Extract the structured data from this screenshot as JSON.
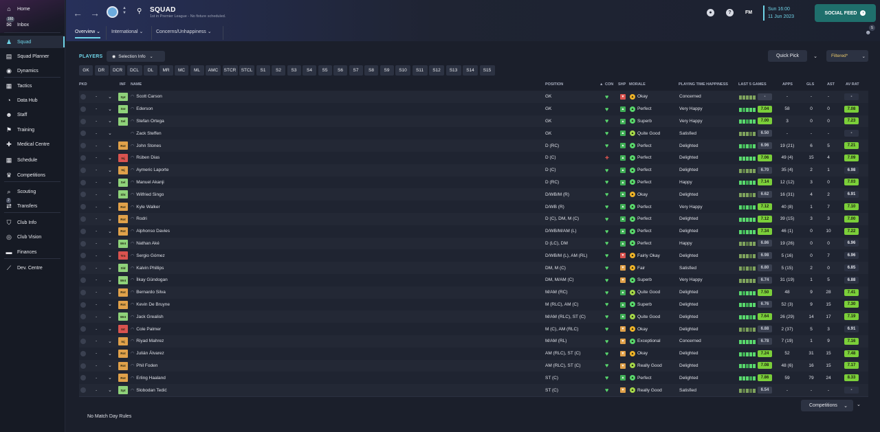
{
  "sidebar": {
    "items": [
      {
        "label": "Home",
        "icon": "home-icon"
      },
      {
        "label": "Inbox",
        "icon": "inbox-icon",
        "badge": "160"
      },
      {
        "label": "Squad",
        "icon": "squad-icon",
        "active": true
      },
      {
        "label": "Squad Planner",
        "icon": "planner-icon"
      },
      {
        "label": "Dynamics",
        "icon": "dynamics-icon"
      },
      {
        "label": "Tactics",
        "icon": "tactics-icon"
      },
      {
        "label": "Data Hub",
        "icon": "data-hub-icon"
      },
      {
        "label": "Staff",
        "icon": "staff-icon"
      },
      {
        "label": "Training",
        "icon": "training-icon"
      },
      {
        "label": "Medical Centre",
        "icon": "medical-icon"
      },
      {
        "label": "Schedule",
        "icon": "schedule-icon"
      },
      {
        "label": "Competitions",
        "icon": "trophy-icon"
      },
      {
        "label": "Scouting",
        "icon": "scouting-icon"
      },
      {
        "label": "Transfers",
        "icon": "transfers-icon",
        "badge": "2"
      },
      {
        "label": "Club Info",
        "icon": "club-info-icon"
      },
      {
        "label": "Club Vision",
        "icon": "club-vision-icon"
      },
      {
        "label": "Finances",
        "icon": "finances-icon"
      },
      {
        "label": "Dev. Centre",
        "icon": "dev-centre-icon"
      }
    ]
  },
  "header": {
    "title": "SQUAD",
    "subtitle": "1st in Premier League - No fixture scheduled.",
    "tabs": [
      "Overview",
      "International",
      "Concerns/Unhappiness"
    ],
    "fm": "FM",
    "date_line1": "Sun 16:00",
    "date_line2": "11 Jun 2023",
    "social_feed": "SOCIAL FEED",
    "notif_count": "5"
  },
  "toolbar": {
    "players_label": "PLAYERS",
    "selection_info": "Selection Info",
    "quick_pick": "Quick Pick",
    "filtered": "Filtered*",
    "positions": [
      "GK",
      "DR",
      "DCR",
      "DCL",
      "DL",
      "MR",
      "MC",
      "ML",
      "AMC",
      "STCR",
      "STCL",
      "S1",
      "S2",
      "S3",
      "S4",
      "S5",
      "S6",
      "S7",
      "S8",
      "S9",
      "S10",
      "S11",
      "S12",
      "S13",
      "S14",
      "S15"
    ]
  },
  "columns": {
    "pkd": "PKD",
    "inf": "INF",
    "name": "NAME",
    "position": "POSITION",
    "con": "CON",
    "shp": "SHP",
    "morale": "MORALE",
    "happiness": "PLAYING TIME HAPPINESS",
    "last5": "LAST 5 GAMES",
    "apps": "APPS",
    "gls": "GLS",
    "ast": "AST",
    "avrat": "AV RAT"
  },
  "players": [
    {
      "name": "Scott Carson",
      "inf": "Spt",
      "inf_color": "#8fd27a",
      "position": "GK",
      "shp": "down",
      "morale": "Okay",
      "morale_color": "#f0b429",
      "happiness": "Concerned",
      "form": "-",
      "apps": "-",
      "gls": "-",
      "ast": "-",
      "avrat": "-",
      "gray": true
    },
    {
      "name": "Ederson",
      "inf": "SnI",
      "inf_color": "#8fd27a",
      "position": "GK",
      "shp": "up",
      "morale": "Perfect",
      "morale_color": "#59d86d",
      "happiness": "Very Happy",
      "form": "7.04",
      "apps": "58",
      "gls": "0",
      "ast": "0",
      "avrat": "7.08"
    },
    {
      "name": "Stefan Ortega",
      "inf": "Sel",
      "inf_color": "#8fd27a",
      "position": "GK",
      "shp": "up",
      "morale": "Superb",
      "morale_color": "#59d86d",
      "happiness": "Very Happy",
      "form": "7.00",
      "apps": "3",
      "gls": "0",
      "ast": "0",
      "avrat": "7.23"
    },
    {
      "name": "Zack Steffen",
      "inf": "",
      "inf_color": "",
      "position": "GK",
      "shp": "up",
      "morale": "Quite Good",
      "morale_color": "#a6d94a",
      "happiness": "Satisfied",
      "form": "6.50",
      "apps": "-",
      "gls": "-",
      "ast": "-",
      "avrat": "-",
      "gray": true
    },
    {
      "name": "John Stones",
      "inf": "Rot",
      "inf_color": "#e0a14a",
      "position": "D (RC)",
      "shp": "up",
      "morale": "Perfect",
      "morale_color": "#59d86d",
      "happiness": "Delighted",
      "form": "6.96",
      "apps": "19 (21)",
      "gls": "6",
      "ast": "5",
      "avrat": "7.21"
    },
    {
      "name": "Rúben Dias",
      "inf": "Inj",
      "inf_color": "#d9534f",
      "position": "D (C)",
      "shp": "up",
      "morale": "Perfect",
      "morale_color": "#59d86d",
      "happiness": "Delighted",
      "form": "7.06",
      "apps": "49 (4)",
      "gls": "15",
      "ast": "4",
      "avrat": "7.09"
    },
    {
      "name": "Aymeric Laporte",
      "inf": "Inj",
      "inf_color": "#e0a14a",
      "position": "D (C)",
      "shp": "up",
      "morale": "Perfect",
      "morale_color": "#59d86d",
      "happiness": "Delighted",
      "form": "6.70",
      "apps": "35 (4)",
      "gls": "2",
      "ast": "1",
      "avrat": "6.98",
      "gray": true
    },
    {
      "name": "Manuel Akanji",
      "inf": "Sel",
      "inf_color": "#8fd27a",
      "position": "D (RC)",
      "shp": "up",
      "morale": "Perfect",
      "morale_color": "#59d86d",
      "happiness": "Happy",
      "form": "7.14",
      "apps": "12 (12)",
      "gls": "3",
      "ast": "0",
      "avrat": "7.03"
    },
    {
      "name": "Wilfried Singo",
      "inf": "Sht",
      "inf_color": "#8fd27a",
      "position": "D/WB/M (R)",
      "shp": "up",
      "morale": "Okay",
      "morale_color": "#f0b429",
      "happiness": "Delighted",
      "form": "6.62",
      "apps": "16 (31)",
      "gls": "4",
      "ast": "2",
      "avrat": "6.91",
      "gray": true
    },
    {
      "name": "Kyle Walker",
      "inf": "Rot",
      "inf_color": "#e0a14a",
      "position": "D/WB (R)",
      "shp": "up",
      "morale": "Perfect",
      "morale_color": "#59d86d",
      "happiness": "Very Happy",
      "form": "7.12",
      "apps": "40 (8)",
      "gls": "1",
      "ast": "7",
      "avrat": "7.10"
    },
    {
      "name": "Rodri",
      "inf": "Rot",
      "inf_color": "#e0a14a",
      "position": "D (C), DM, M (C)",
      "shp": "up",
      "morale": "Perfect",
      "morale_color": "#59d86d",
      "happiness": "Delighted",
      "form": "7.12",
      "apps": "39 (15)",
      "gls": "3",
      "ast": "3",
      "avrat": "7.00"
    },
    {
      "name": "Alphonso Davies",
      "inf": "Rot",
      "inf_color": "#e0a14a",
      "position": "D/WB/M/AM (L)",
      "shp": "up",
      "morale": "Perfect",
      "morale_color": "#59d86d",
      "happiness": "Delighted",
      "form": "7.34",
      "apps": "46 (1)",
      "gls": "0",
      "ast": "10",
      "avrat": "7.22"
    },
    {
      "name": "Nathan Aké",
      "inf": "Wnt",
      "inf_color": "#8fd27a",
      "position": "D (LC), DM",
      "shp": "up",
      "morale": "Perfect",
      "morale_color": "#59d86d",
      "happiness": "Happy",
      "form": "6.86",
      "apps": "19 (26)",
      "gls": "0",
      "ast": "0",
      "avrat": "6.96",
      "gray": true
    },
    {
      "name": "Sergio Gómez",
      "inf": "Trn",
      "inf_color": "#d9534f",
      "position": "D/WB/M (L), AM (RL)",
      "shp": "down",
      "morale": "Fairly Okay",
      "morale_color": "#f0b429",
      "happiness": "Delighted",
      "form": "6.98",
      "apps": "5 (16)",
      "gls": "0",
      "ast": "7",
      "avrat": "6.96",
      "gray": true
    },
    {
      "name": "Kalvin Phillips",
      "inf": "Sld",
      "inf_color": "#8fd27a",
      "position": "DM, M (C)",
      "shp": "down",
      "morale": "Fair",
      "morale_color": "#f0b429",
      "happiness": "Satisfied",
      "form": "6.80",
      "apps": "5 (15)",
      "gls": "2",
      "ast": "0",
      "avrat": "6.85",
      "gray": true
    },
    {
      "name": "İlkay Gündogan",
      "inf": "Wnt",
      "inf_color": "#8fd27a",
      "position": "DM, M/AM (C)",
      "shp": "down",
      "morale": "Superb",
      "morale_color": "#59d86d",
      "happiness": "Very Happy",
      "form": "6.74",
      "apps": "31 (19)",
      "gls": "1",
      "ast": "5",
      "avrat": "6.88",
      "gray": true
    },
    {
      "name": "Bernardo Silva",
      "inf": "Rot",
      "inf_color": "#e0a14a",
      "position": "M/AM (RC)",
      "shp": "up",
      "morale": "Quite Good",
      "morale_color": "#a6d94a",
      "happiness": "Delighted",
      "form": "7.50",
      "apps": "48",
      "gls": "9",
      "ast": "28",
      "avrat": "7.41"
    },
    {
      "name": "Kevin De Bruyne",
      "inf": "Rot",
      "inf_color": "#e0a14a",
      "position": "M (RLC), AM (C)",
      "shp": "up",
      "morale": "Superb",
      "morale_color": "#59d86d",
      "happiness": "Delighted",
      "form": "6.76",
      "apps": "52 (3)",
      "gls": "9",
      "ast": "15",
      "avrat": "7.30"
    },
    {
      "name": "Jack Grealish",
      "inf": "Wnt",
      "inf_color": "#8fd27a",
      "position": "M/AM (RLC), ST (C)",
      "shp": "up",
      "morale": "Quite Good",
      "morale_color": "#a6d94a",
      "happiness": "Delighted",
      "form": "7.64",
      "apps": "26 (29)",
      "gls": "14",
      "ast": "17",
      "avrat": "7.19"
    },
    {
      "name": "Cole Palmer",
      "inf": "Int",
      "inf_color": "#d9534f",
      "position": "M (C), AM (RLC)",
      "shp": "down",
      "morale": "Okay",
      "morale_color": "#f0b429",
      "happiness": "Delighted",
      "form": "6.88",
      "apps": "2 (37)",
      "gls": "5",
      "ast": "3",
      "avrat": "6.91",
      "gray": true
    },
    {
      "name": "Riyad Mahrez",
      "inf": "Inj",
      "inf_color": "#e0a14a",
      "position": "M/AM (RL)",
      "shp": "down",
      "morale": "Exceptional",
      "morale_color": "#59d86d",
      "happiness": "Concerned",
      "form": "6.78",
      "apps": "7 (19)",
      "gls": "1",
      "ast": "9",
      "avrat": "7.16"
    },
    {
      "name": "Julián Álvarez",
      "inf": "Rot",
      "inf_color": "#e0a14a",
      "position": "AM (RLC), ST (C)",
      "shp": "down",
      "morale": "Okay",
      "morale_color": "#f0b429",
      "happiness": "Delighted",
      "form": "7.24",
      "apps": "52",
      "gls": "31",
      "ast": "15",
      "avrat": "7.48"
    },
    {
      "name": "Phil Foden",
      "inf": "Rot",
      "inf_color": "#e0a14a",
      "position": "AM (RLC), ST (C)",
      "shp": "down",
      "morale": "Really Good",
      "morale_color": "#a6d94a",
      "happiness": "Delighted",
      "form": "7.08",
      "apps": "48 (6)",
      "gls": "16",
      "ast": "15",
      "avrat": "7.17"
    },
    {
      "name": "Erling Haaland",
      "inf": "Rot",
      "inf_color": "#e0a14a",
      "position": "ST (C)",
      "shp": "up",
      "morale": "Perfect",
      "morale_color": "#59d86d",
      "happiness": "Delighted",
      "form": "7.86",
      "apps": "59",
      "gls": "79",
      "ast": "24",
      "avrat": "8.33"
    },
    {
      "name": "Slobodan Tedić",
      "inf": "Spt",
      "inf_color": "#8fd27a",
      "position": "ST (C)",
      "shp": "down",
      "morale": "Really Good",
      "morale_color": "#a6d94a",
      "happiness": "Satisfied",
      "form": "6.54",
      "apps": "-",
      "gls": "-",
      "ast": "-",
      "avrat": "-",
      "gray": true
    }
  ],
  "footer": {
    "competitions": "Competitions",
    "no_match_day_rules": "No Match Day Rules"
  },
  "colors": {
    "accent": "#6fd5e8",
    "good": "#59d86d",
    "social": "#1f6f6c"
  }
}
